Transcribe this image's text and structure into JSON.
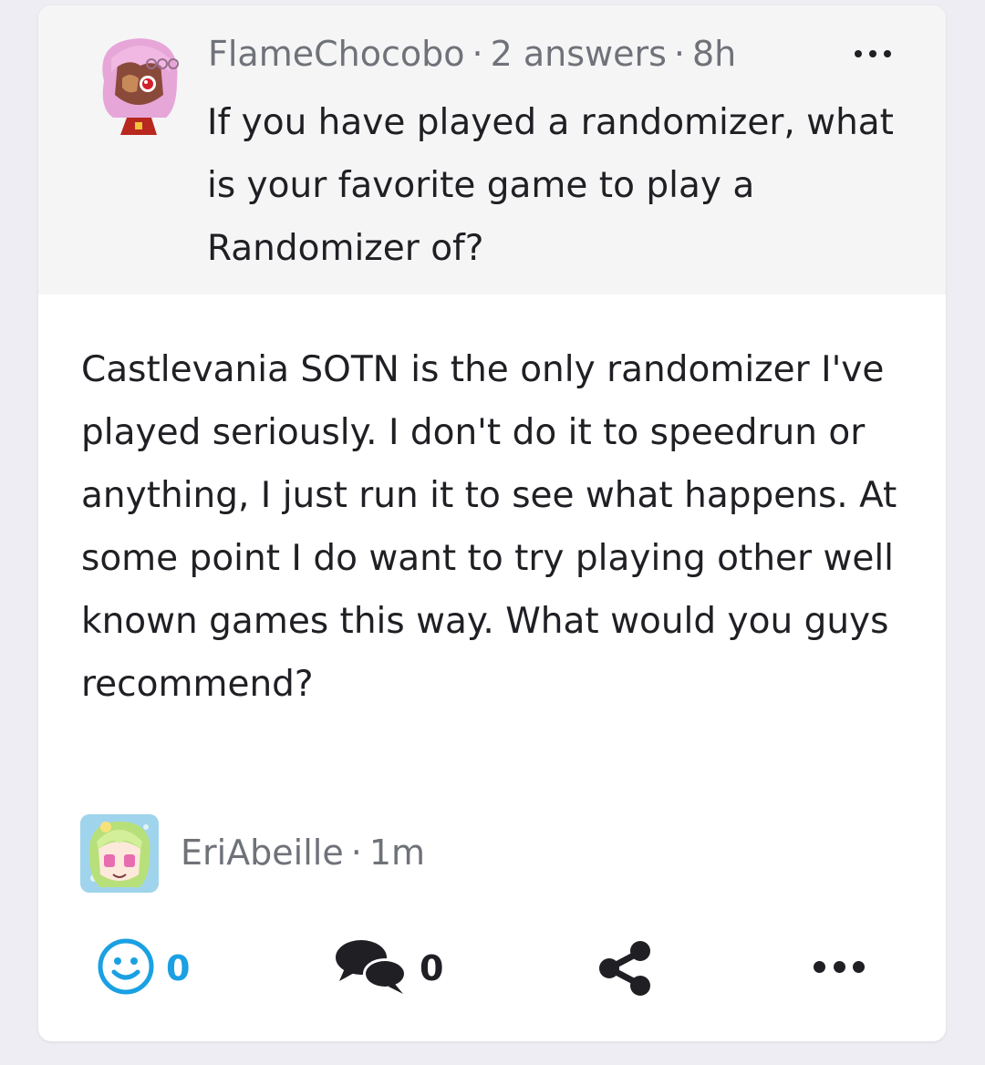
{
  "question": {
    "author": "FlameChocobo",
    "answers": "2 answers",
    "time": "8h",
    "separator": "·",
    "title": "If you have played a randomizer, what is your favorite game to play a Randomizer of?",
    "avatar_icon": "anime-girl-pink-hair-avatar"
  },
  "answer": {
    "body": "Castlevania SOTN is the only randomizer I've played seriously. I don't do it to speedrun or anything, I just run it to see what happens. At some point I do want to try playing other well known games this way. What would you guys recommend?",
    "author": "EriAbeille",
    "time": "1m",
    "separator": "·",
    "avatar_icon": "anime-girl-green-hair-avatar"
  },
  "actions": {
    "reactions_count": "0",
    "comments_count": "0",
    "reaction_icon": "smiley-icon",
    "comment_icon": "speech-bubbles-icon",
    "share_icon": "share-icon",
    "more_icon": "more-dots-icon"
  },
  "colors": {
    "accent": "#1aa0e3",
    "meta_text": "#6f7279",
    "question_bg": "#f5f5f6",
    "page_bg": "#eeedf3"
  }
}
